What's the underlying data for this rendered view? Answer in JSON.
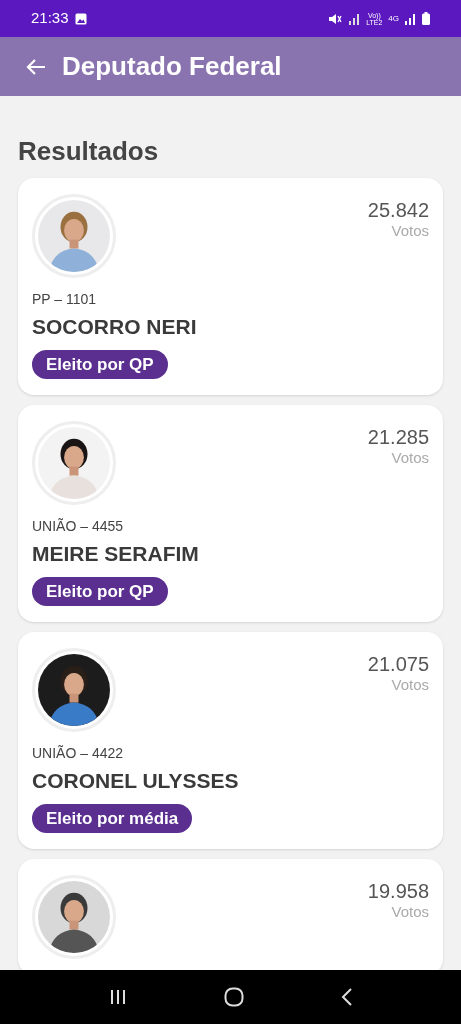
{
  "status_bar": {
    "time": "21:33",
    "network_label": "Vo)) LTE2",
    "data_label": "4G"
  },
  "app_bar": {
    "title": "Deputado Federal"
  },
  "section_title": "Resultados",
  "candidates": [
    {
      "party": "PP – 1101",
      "name": "SOCORRO NERI",
      "votes": "25.842",
      "votes_label": "Votos",
      "status": "Eleito por QP"
    },
    {
      "party": "UNIÃO – 4455",
      "name": "MEIRE SERAFIM",
      "votes": "21.285",
      "votes_label": "Votos",
      "status": "Eleito por QP"
    },
    {
      "party": "UNIÃO – 4422",
      "name": "CORONEL ULYSSES",
      "votes": "21.075",
      "votes_label": "Votos",
      "status": "Eleito por média"
    },
    {
      "votes": "19.958",
      "votes_label": "Votos"
    }
  ]
}
